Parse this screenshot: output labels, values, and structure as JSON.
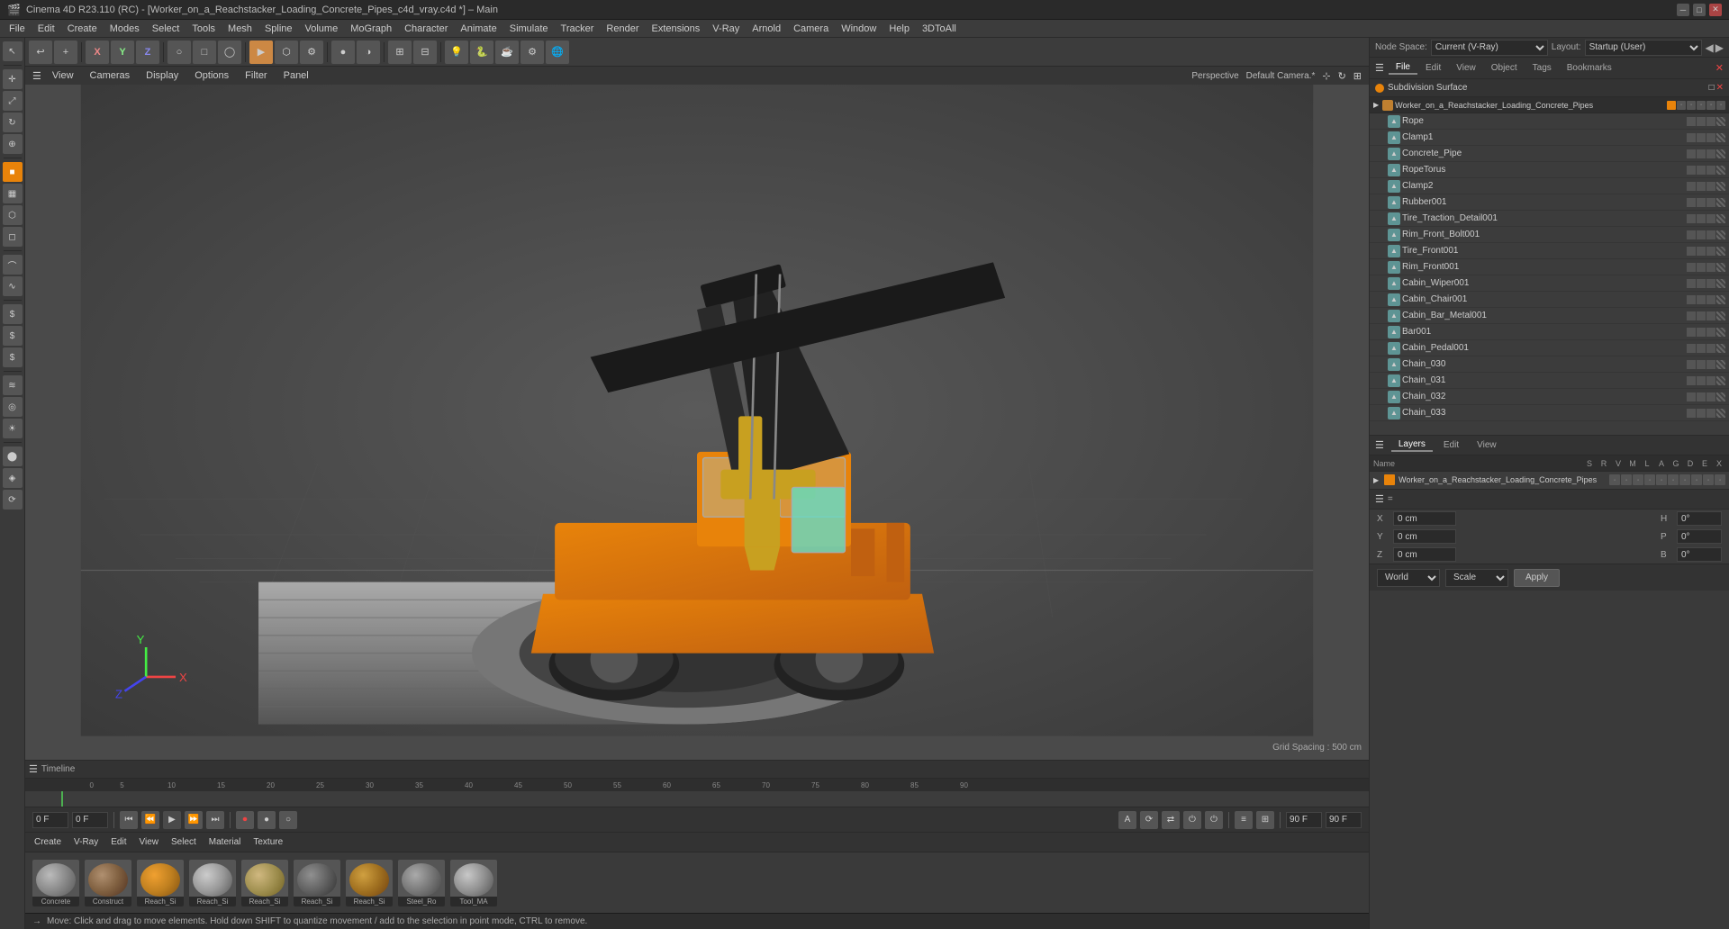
{
  "app": {
    "title": "Cinema 4D R23.110 (RC) - [Worker_on_a_Reachstacker_Loading_Concrete_Pipes_c4d_vray.c4d *] – Main"
  },
  "menubar": {
    "items": [
      "File",
      "Edit",
      "Create",
      "Modes",
      "Select",
      "Tools",
      "Mesh",
      "Spline",
      "Volume",
      "MoGraph",
      "Character",
      "Animate",
      "Simulate",
      "Tracker",
      "Render",
      "Extensions",
      "V-Ray",
      "Arnold",
      "Camera",
      "Window",
      "Help",
      "3DToAll"
    ]
  },
  "viewport": {
    "mode_label": "Perspective",
    "camera_label": "Default Camera.*",
    "grid_spacing": "Grid Spacing : 500 cm",
    "menu_items": [
      "View",
      "Cameras",
      "Display",
      "Options",
      "Filter",
      "Panel"
    ]
  },
  "timeline": {
    "start_frame": "0 F",
    "end_frame": "90 F",
    "current_frame": "0 F",
    "current_time": "0 F",
    "max_time": "90 F"
  },
  "bottom_toolbar": {
    "tabs": [
      "Create",
      "V-Ray",
      "Edit",
      "View",
      "Select",
      "Material",
      "Texture"
    ]
  },
  "materials": [
    {
      "label": "Concrete",
      "color": "#9a9a9a"
    },
    {
      "label": "Construct",
      "color": "#8a7a6a"
    },
    {
      "label": "Reach_Si",
      "color": "#c8a050"
    },
    {
      "label": "Reach_Si",
      "color": "#a0a0a0"
    },
    {
      "label": "Reach_Si",
      "color": "#b0a080"
    },
    {
      "label": "Reach_Si",
      "color": "#707070"
    },
    {
      "label": "Reach_Si",
      "color": "#c0a060"
    },
    {
      "label": "Steel_Ro",
      "color": "#888888"
    },
    {
      "label": "Tool_MA",
      "color": "#b0b0b0"
    }
  ],
  "statusbar": {
    "message": "Move: Click and drag to move elements. Hold down SHIFT to quantize movement / add to the selection in point mode, CTRL to remove."
  },
  "right_panel": {
    "node_space": "Node Space:",
    "node_space_value": "Current (V-Ray)",
    "layout": "Layout:",
    "layout_value": "Startup (User)",
    "tabs": [
      "File",
      "Edit",
      "View",
      "Object",
      "Tags",
      "Bookmarks"
    ],
    "subdiv_label": "Subdivision Surface",
    "file_name": "Worker_on_a_Reachstacker_Loading_Concrete_Pipes",
    "objects": [
      {
        "name": "Rope",
        "indent": 2,
        "icon": "🔗"
      },
      {
        "name": "Clamp1",
        "indent": 2,
        "icon": "📎"
      },
      {
        "name": "Concrete_Pipe",
        "indent": 2,
        "icon": "⭕"
      },
      {
        "name": "RopeTorus",
        "indent": 2,
        "icon": "🔵"
      },
      {
        "name": "Clamp2",
        "indent": 2,
        "icon": "📎"
      },
      {
        "name": "Rubber001",
        "indent": 2,
        "icon": "⬟"
      },
      {
        "name": "Tire_Traction_Detail001",
        "indent": 2,
        "icon": "⭕"
      },
      {
        "name": "Rim_Front_Bolt001",
        "indent": 2,
        "icon": "⭕"
      },
      {
        "name": "Tire_Front001",
        "indent": 2,
        "icon": "⭕"
      },
      {
        "name": "Rim_Front001",
        "indent": 2,
        "icon": "⭕"
      },
      {
        "name": "Cabin_Wiper001",
        "indent": 2,
        "icon": "⭕"
      },
      {
        "name": "Cabin_Chair001",
        "indent": 2,
        "icon": "⭕"
      },
      {
        "name": "Cabin_Bar_Metal001",
        "indent": 2,
        "icon": "⭕"
      },
      {
        "name": "Bar001",
        "indent": 2,
        "icon": "⭕"
      },
      {
        "name": "Cabin_Pedal001",
        "indent": 2,
        "icon": "⭕"
      },
      {
        "name": "Chain_030",
        "indent": 2,
        "icon": "⭕"
      },
      {
        "name": "Chain_031",
        "indent": 2,
        "icon": "⭕"
      },
      {
        "name": "Chain_032",
        "indent": 2,
        "icon": "⭕"
      },
      {
        "name": "Chain_033",
        "indent": 2,
        "icon": "⭕"
      }
    ],
    "layers": {
      "title": "Layers",
      "columns": [
        "Name",
        "S",
        "R",
        "V",
        "M",
        "L",
        "A",
        "G",
        "D",
        "E",
        "X"
      ],
      "items": [
        {
          "name": "Worker_on_a_Reachstacker_Loading_Concrete_Pipes",
          "color": "#e8830a"
        }
      ]
    },
    "coordinates": {
      "x_pos": "0 cm",
      "y_pos": "0 cm",
      "z_pos": "0 cm",
      "x_size": "",
      "y_size": "",
      "z_size": "",
      "h_rot": "0°",
      "p_rot": "0°",
      "b_rot": "0°",
      "coord_system": "World",
      "transform_mode": "Apply"
    }
  }
}
